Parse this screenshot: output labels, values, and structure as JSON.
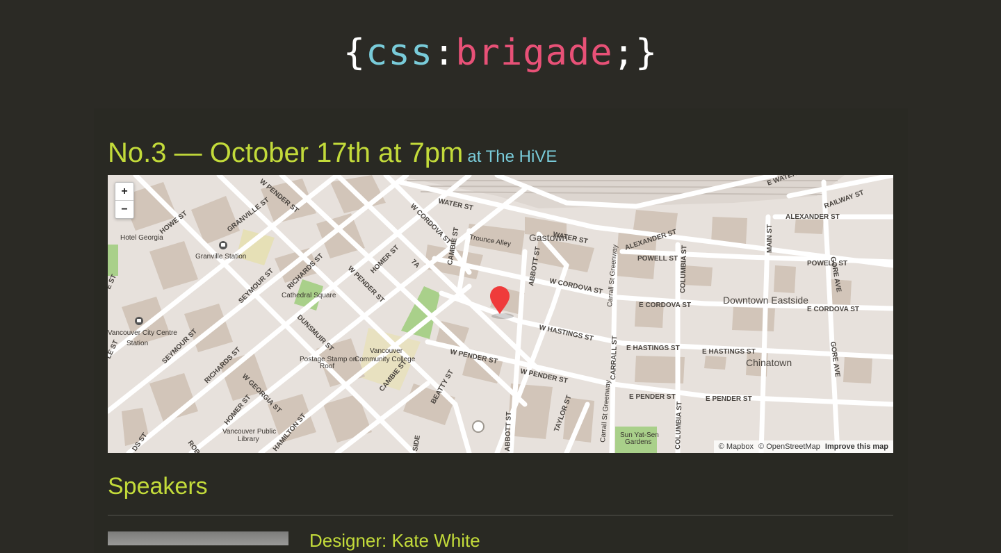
{
  "header": {
    "logo": {
      "open_brace": "{",
      "css": "css",
      "colon": ":",
      "brigade": "brigade",
      "close": ";}"
    }
  },
  "event": {
    "title": "No.3 — October 17th at 7pm",
    "venue_link": "at The HiVE"
  },
  "map": {
    "zoom_in": "+",
    "zoom_out": "−",
    "attribution": {
      "mapbox": "© Mapbox",
      "osm": "© OpenStreetMap",
      "improve": "Improve this map"
    },
    "labels": {
      "w_pender_1": "W PENDER ST",
      "water_st": "WATER ST",
      "w_cordova": "W CORDOVA ST",
      "howe": "HOWE ST",
      "granville_st": "GRANVILLE ST",
      "hotel_georgia": "Hotel Georgia",
      "granville_station": "Granville Station",
      "trounce": "Trounce Alley",
      "gastown": "Gastown",
      "water_st_2": "WATER ST",
      "alexander_1": "ALEXANDER ST",
      "alexander_2": "ALEXANDER ST",
      "e_waterfront": "E WATERFRONT",
      "railway": "RAILWAY ST",
      "main": "MAIN ST",
      "gore_1": "GORE AVE",
      "powell_1": "POWELL ST",
      "powell_2": "POWELL ST",
      "columbia_1": "COLUMBIA ST",
      "carrall_greenway_1": "Carrall St Greenway",
      "abbott_1": "ABBOTT ST",
      "w_cordova_2": "W CORDOVA ST",
      "e_cordova_1": "E CORDOVA ST",
      "e_cordova_2": "E CORDOVA ST",
      "downtown_eastside": "Downtown Eastside",
      "seymour_1": "SEYMOUR ST",
      "richards_1": "RICHARDS ST",
      "w_pender_2": "W PENDER ST",
      "homer_1": "HOMER ST",
      "seven_a": "7A",
      "cambie_1": "CAMBIE ST",
      "cathedral": "Cathedral Square",
      "w_hastings": "W HASTINGS ST",
      "e_hastings_1": "E HASTINGS ST",
      "e_hastings_2": "E HASTINGS ST",
      "carrall_st": "CARRALL ST",
      "chinatown": "Chinatown",
      "vcc_station_1": "Vancouver City Centre",
      "vcc_station_2": "Station",
      "dunsmuir": "DUNSMUIR ST",
      "vcc_college_1": "Vancouver",
      "vcc_college_2": "Community College",
      "postage_1": "Postage Stamp on",
      "postage_2": "Roof",
      "w_pender_3": "W PENDER ST",
      "w_pender_4": "W PENDER ST",
      "seymour_2": "SEYMOUR ST",
      "richards_2": "RICHARDS ST",
      "w_georgia": "W GEORGIA ST",
      "cambie_2": "CAMBIE ST",
      "beatty": "BEATTY ST",
      "e_pender_1": "E PENDER ST",
      "e_pender_2": "E PENDER ST",
      "gore_2": "GORE AVE",
      "homer_2": "HOMER ST",
      "hamilton": "HAMILTON ST",
      "taylor": "TAYLOR ST",
      "abbott_2": "ABBOTT ST",
      "carrall_greenway_2": "Carrall St Greenway",
      "columbia_2": "COLUMBIA ST",
      "sun_yat_sen_1": "Sun Yat-Sen",
      "sun_yat_sen_2": "Gardens",
      "vpl_1": "Vancouver Public",
      "vpl_2": "Library",
      "robson": "ROBSON",
      "w_edge_1": "E ST",
      "w_edge_2": "LE ST",
      "sw_edge": "DS ST",
      "bottom_edge": "SIDE"
    }
  },
  "speakers_section": {
    "heading": "Speakers",
    "first_speaker_name": "Designer: Kate White"
  }
}
